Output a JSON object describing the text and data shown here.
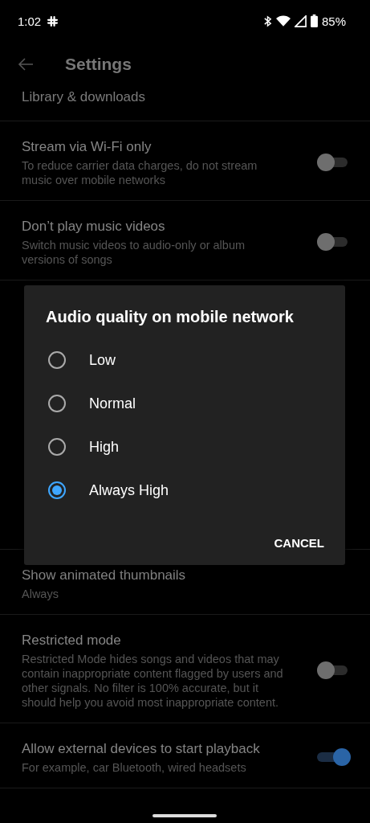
{
  "status_bar": {
    "time": "1:02",
    "battery": "85%"
  },
  "app_bar": {
    "title": "Settings"
  },
  "section_header": "Library & downloads",
  "settings_above": [
    {
      "kind": "toggle",
      "title": "Stream via Wi-Fi only",
      "subtitle": "To reduce carrier data charges, do not stream music over mobile networks",
      "on": false
    },
    {
      "kind": "toggle",
      "title": "Don’t play music videos",
      "subtitle": "Switch music videos to audio-only or album versions of songs",
      "on": false
    }
  ],
  "settings_below": [
    {
      "kind": "value",
      "title": "Show animated thumbnails",
      "subtitle": "Always"
    },
    {
      "kind": "toggle",
      "title": "Restricted mode",
      "subtitle": "Restricted Mode hides songs and videos that may contain inappropriate content flagged by users and other signals. No filter is 100% accurate, but it should help you avoid most inappropriate content.",
      "on": false
    },
    {
      "kind": "toggle",
      "title": "Allow external devices to start playback",
      "subtitle": "For example, car Bluetooth, wired headsets",
      "on": true
    }
  ],
  "dialog": {
    "title": "Audio quality on mobile network",
    "options": [
      {
        "label": "Low",
        "selected": false
      },
      {
        "label": "Normal",
        "selected": false
      },
      {
        "label": "High",
        "selected": false
      },
      {
        "label": "Always High",
        "selected": true
      }
    ],
    "buttons": [
      "CANCEL"
    ]
  }
}
